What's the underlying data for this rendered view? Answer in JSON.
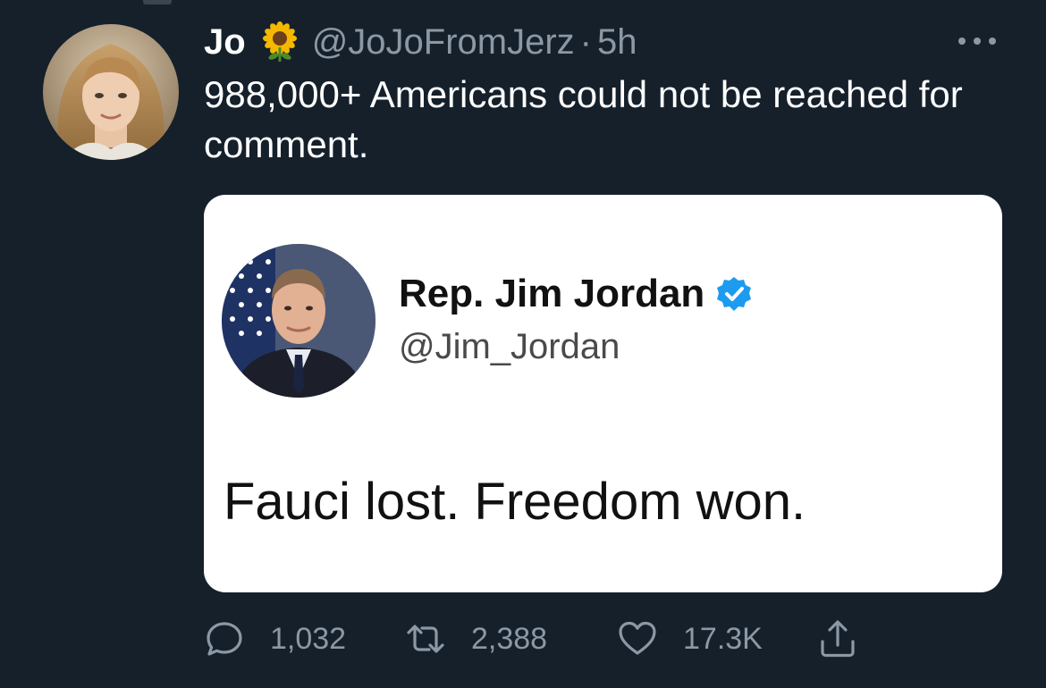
{
  "tweet": {
    "author": {
      "display_name": "Jo",
      "handle": "@JoJoFromJerz",
      "name_emoji_icon": "sunflower-icon"
    },
    "separator": "·",
    "time": "5h",
    "more_icon": "ellipsis-icon",
    "text": "988,000+ Americans could not be reached for comment."
  },
  "quoted_screenshot": {
    "name": "Rep. Jim Jordan",
    "verified_icon": "verified-badge-icon",
    "handle": "@Jim_Jordan",
    "text": "Fauci lost. Freedom won."
  },
  "actions": {
    "reply": {
      "icon": "reply-icon",
      "count": "1,032"
    },
    "retweet": {
      "icon": "retweet-icon",
      "count": "2,388"
    },
    "like": {
      "icon": "heart-icon",
      "count": "17.3K"
    },
    "share": {
      "icon": "share-icon"
    }
  },
  "colors": {
    "background": "#15202b",
    "secondary_text": "#8b98a5",
    "verified_blue": "#1d9bf0"
  }
}
